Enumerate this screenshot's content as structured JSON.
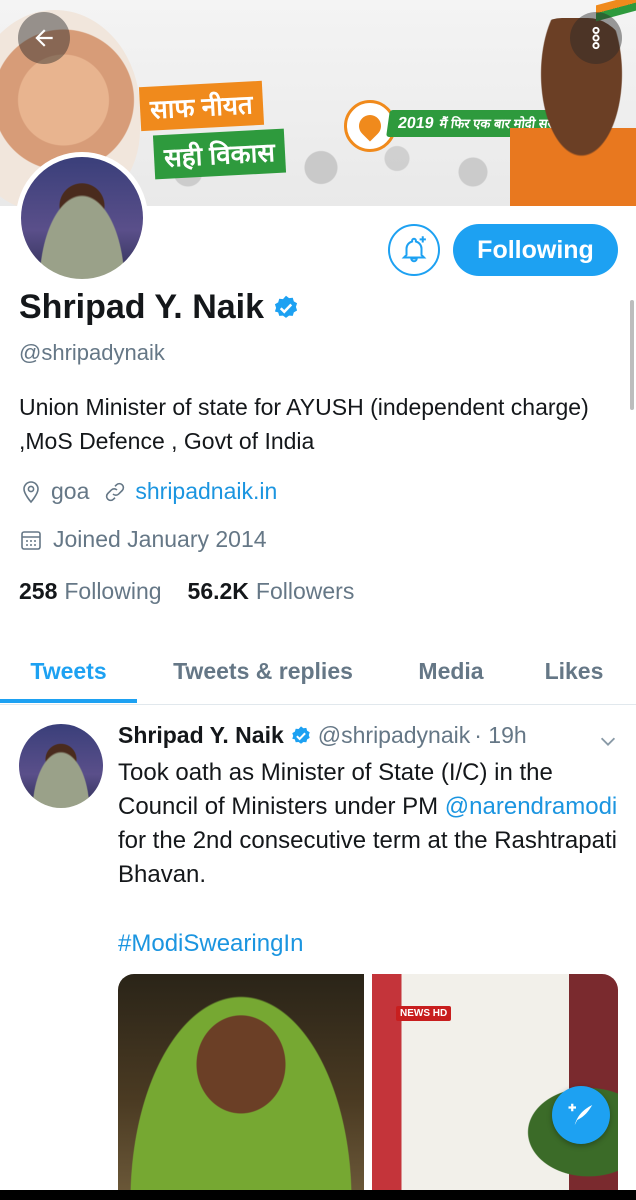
{
  "banner": {
    "slogan_line1": "साफ नीयत",
    "slogan_line2": "सही विकास",
    "campaign_year": "2019",
    "campaign_text": "मैं फिर एक बार मोदी सरकार"
  },
  "profile": {
    "name": "Shripad Y. Naik",
    "handle": "@shripadynaik",
    "bio": "Union Minister of state for AYUSH (independent charge) ,MoS Defence , Govt of India",
    "location": "goa",
    "website": "shripadnaik.in",
    "joined": "Joined January 2014",
    "following_count": "258",
    "following_label": "Following",
    "followers_count": "56.2K",
    "followers_label": "Followers",
    "follow_button": "Following"
  },
  "tabs": [
    {
      "label": "Tweets",
      "active": true
    },
    {
      "label": "Tweets & replies",
      "active": false
    },
    {
      "label": "Media",
      "active": false
    },
    {
      "label": "Likes",
      "active": false
    }
  ],
  "tweet": {
    "author": "Shripad Y. Naik",
    "handle": "@shripadynaik",
    "time": "· 19h",
    "text_part1": "Took oath as Minister of State (I/C) in the Council of Ministers under PM ",
    "mention": "@narendramodi",
    "text_part2": " for the 2nd consecutive term at the Rashtrapati Bhavan.",
    "hashtag": "#ModiSwearingIn",
    "media_badge": "NEWS HD"
  },
  "icons": {
    "back": "arrow-left-icon",
    "more": "more-vertical-icon",
    "bell": "bell-plus-icon",
    "verified": "verified-badge-icon",
    "location": "location-pin-icon",
    "link": "link-icon",
    "calendar": "calendar-icon",
    "compose": "compose-tweet-icon",
    "chevron": "chevron-down-icon"
  },
  "colors": {
    "accent": "#1da1f2",
    "link": "#1b95e0",
    "secondary_text": "#657786"
  }
}
